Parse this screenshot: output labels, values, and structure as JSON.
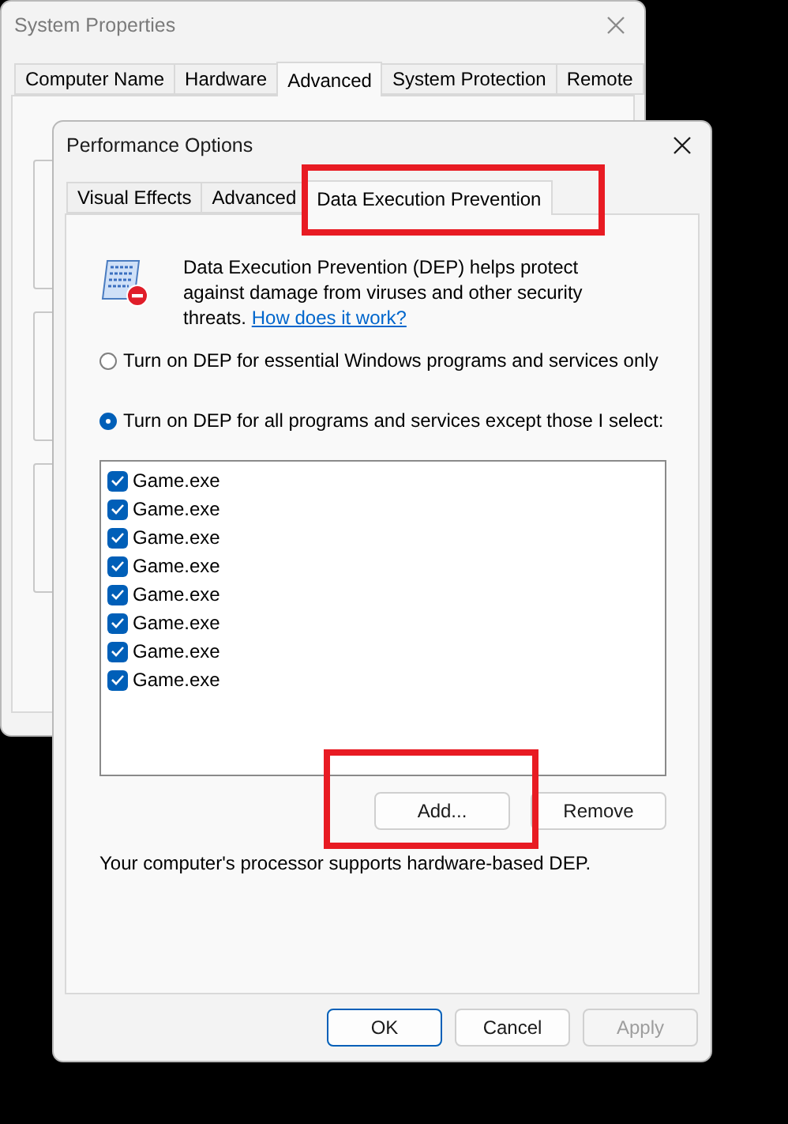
{
  "background_window": {
    "title": "System Properties",
    "tabs": [
      {
        "label": "Computer Name",
        "selected": false
      },
      {
        "label": "Hardware",
        "selected": false
      },
      {
        "label": "Advanced",
        "selected": true
      },
      {
        "label": "System Protection",
        "selected": false
      },
      {
        "label": "Remote",
        "selected": false
      }
    ]
  },
  "dialog": {
    "title": "Performance Options",
    "tabs": [
      {
        "label": "Visual Effects",
        "selected": false,
        "highlighted": false
      },
      {
        "label": "Advanced",
        "selected": false,
        "highlighted": false
      },
      {
        "label": "Data Execution Prevention",
        "selected": true,
        "highlighted": true
      }
    ],
    "description": "Data Execution Prevention (DEP) helps protect against damage from viruses and other security threats.",
    "help_link": "How does it work?",
    "options": [
      {
        "label": "Turn on DEP for essential Windows programs and services only",
        "selected": false
      },
      {
        "label": "Turn on DEP for all programs and services except those I select:",
        "selected": true
      }
    ],
    "programs": [
      {
        "name": "Game.exe",
        "checked": true
      },
      {
        "name": "Game.exe",
        "checked": true
      },
      {
        "name": "Game.exe",
        "checked": true
      },
      {
        "name": "Game.exe",
        "checked": true
      },
      {
        "name": "Game.exe",
        "checked": true
      },
      {
        "name": "Game.exe",
        "checked": true
      },
      {
        "name": "Game.exe",
        "checked": true
      },
      {
        "name": "Game.exe",
        "checked": true
      }
    ],
    "list_buttons": [
      {
        "label": "Add...",
        "highlighted": true
      },
      {
        "label": "Remove",
        "highlighted": false
      }
    ],
    "status": "Your computer's processor supports hardware-based DEP.",
    "buttons": [
      {
        "label": "OK",
        "default": true,
        "disabled": false
      },
      {
        "label": "Cancel",
        "default": false,
        "disabled": false
      },
      {
        "label": "Apply",
        "default": false,
        "disabled": true
      }
    ]
  }
}
